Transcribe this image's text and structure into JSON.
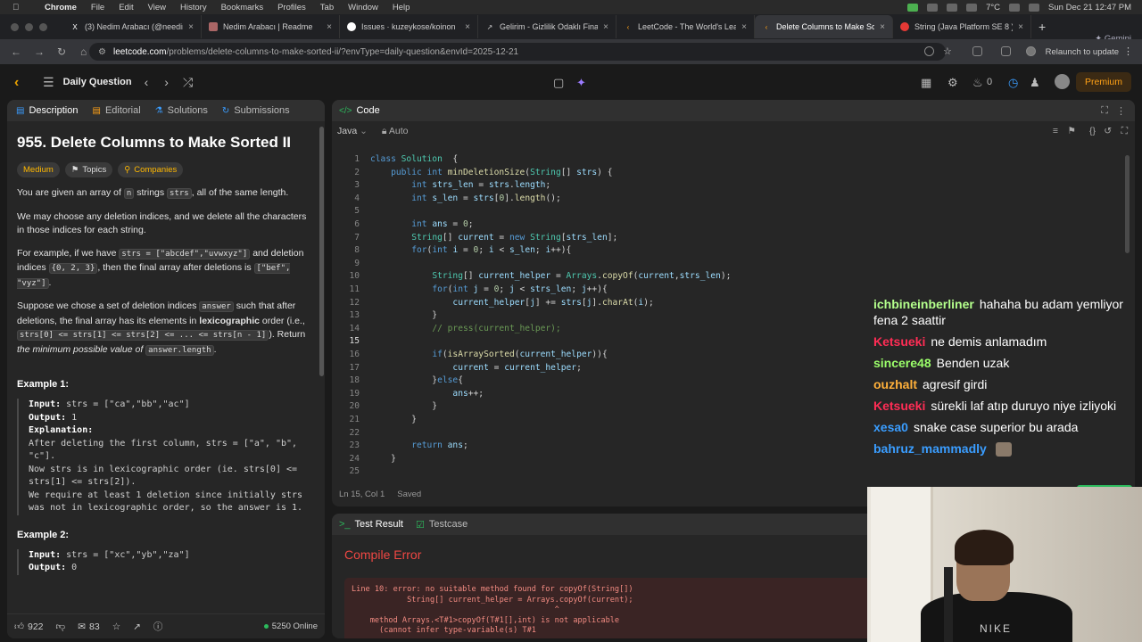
{
  "menubar": {
    "app": "Chrome",
    "items": [
      "File",
      "Edit",
      "View",
      "History",
      "Bookmarks",
      "Profiles",
      "Tab",
      "Window",
      "Help"
    ],
    "temp": "7°C",
    "clock": "Sun Dec 21  12:47 PM"
  },
  "tabs": [
    {
      "title": "(3) Nedim Arabacı (@needim",
      "icon": "x-icon",
      "color": "#ffffff"
    },
    {
      "title": "Nedim Arabacı | Readme",
      "icon": "readme-icon",
      "color": "#a66"
    },
    {
      "title": "Issues · kuzeykose/koinon",
      "icon": "github-icon",
      "color": "#ffffff"
    },
    {
      "title": "Gelirim - Gizlilik Odaklı Finan",
      "icon": "link-icon",
      "color": "#cccccc"
    },
    {
      "title": "LeetCode - The World's Lea",
      "icon": "leetcode-icon",
      "color": "#ffa116"
    },
    {
      "title": "Delete Columns to Make Sor",
      "icon": "leetcode-icon",
      "color": "#ffa116",
      "active": true
    },
    {
      "title": "String (Java Platform SE 8 )",
      "icon": "oracle-icon",
      "color": "#e53935"
    }
  ],
  "gemini": "Gemini",
  "address": {
    "host": "leetcode.com",
    "path": "/problems/delete-columns-to-make-sorted-ii/?envType=daily-question&envId=2025-12-21",
    "relaunch": "Relaunch to update"
  },
  "header": {
    "daily": "Daily Question",
    "fire_count": "0",
    "premium": "Premium"
  },
  "left_tabs": [
    "Description",
    "Editorial",
    "Solutions",
    "Submissions"
  ],
  "problem": {
    "title": "955. Delete Columns to Make Sorted II",
    "difficulty": "Medium",
    "topics": "Topics",
    "companies": "Companies",
    "p1a": "You are given an array of ",
    "p1n": "n",
    "p1b": " strings ",
    "p1strs": "strs",
    "p1c": ", all of the same length.",
    "p2": "We may choose any deletion indices, and we delete all the characters in those indices for each string.",
    "p3a": "For example, if we have ",
    "p3code1": "strs = [\"abcdef\",\"uvwxyz\"]",
    "p3b": " and deletion indices ",
    "p3code2": "{0, 2, 3}",
    "p3c": ", then the final array after deletions is ",
    "p3code3": "[\"bef\", \"vyz\"]",
    "p3d": ".",
    "p4a": "Suppose we chose a set of deletion indices ",
    "p4code1": "answer",
    "p4b": " such that after deletions, the final array has its elements in ",
    "p4bold": "lexicographic",
    "p4c": " order (i.e., ",
    "p4code2": "strs[0] <= strs[1] <= strs[2] <= ... <= strs[n - 1]",
    "p4d": "). Return ",
    "p4em": "the minimum possible value of",
    "p4code3": "answer.length",
    "p4e": ".",
    "ex1_title": "Example 1:",
    "ex1_input_label": "Input:",
    "ex1_input": " strs = [\"ca\",\"bb\",\"ac\"]",
    "ex1_output_label": "Output:",
    "ex1_output": " 1",
    "ex1_expl_label": "Explanation:",
    "ex1_expl": "After deleting the first column, strs = [\"a\", \"b\", \"c\"].\nNow strs is in lexicographic order (ie. strs[0] <= strs[1] <= strs[2]).\nWe require at least 1 deletion since initially strs was not in lexicographic order, so the answer is 1.",
    "ex2_title": "Example 2:",
    "ex2_input_label": "Input:",
    "ex2_input": " strs = [\"xc\",\"yb\",\"za\"]",
    "ex2_output_label": "Output:",
    "ex2_output": " 0"
  },
  "left_footer": {
    "likes": "922",
    "comments": "83",
    "online": "5250 Online"
  },
  "code_panel": {
    "title": "Code",
    "language": "Java",
    "auto": "Auto",
    "status_pos": "Ln 15, Col 1",
    "status_saved": "Saved",
    "current_line": 15,
    "lines": [
      [
        [
          "kw",
          "class "
        ],
        [
          "ty",
          "Solution"
        ],
        [
          "",
          "  {"
        ]
      ],
      [
        [
          "",
          "    "
        ],
        [
          "kw",
          "public int "
        ],
        [
          "fn",
          "minDeletionSize"
        ],
        [
          "",
          "("
        ],
        [
          "ty",
          "String"
        ],
        [
          "",
          "[] "
        ],
        [
          "vr",
          "strs"
        ],
        [
          "",
          ") {"
        ]
      ],
      [
        [
          "",
          "        "
        ],
        [
          "kw",
          "int "
        ],
        [
          "vr",
          "strs_len"
        ],
        [
          "",
          " = "
        ],
        [
          "vr",
          "strs"
        ],
        [
          "",
          "."
        ],
        [
          "vr",
          "length"
        ],
        [
          "",
          ";"
        ]
      ],
      [
        [
          "",
          "        "
        ],
        [
          "kw",
          "int "
        ],
        [
          "vr",
          "s_len"
        ],
        [
          "",
          " = "
        ],
        [
          "vr",
          "strs"
        ],
        [
          "",
          "["
        ],
        [
          "nm",
          "0"
        ],
        [
          "",
          "]."
        ],
        [
          "fn",
          "length"
        ],
        [
          "",
          "();"
        ]
      ],
      [
        [
          "",
          ""
        ]
      ],
      [
        [
          "",
          "        "
        ],
        [
          "kw",
          "int "
        ],
        [
          "vr",
          "ans"
        ],
        [
          "",
          " = "
        ],
        [
          "nm",
          "0"
        ],
        [
          "",
          ";"
        ]
      ],
      [
        [
          "",
          "        "
        ],
        [
          "ty",
          "String"
        ],
        [
          "",
          "[] "
        ],
        [
          "vr",
          "current"
        ],
        [
          "",
          " = "
        ],
        [
          "kw",
          "new "
        ],
        [
          "ty",
          "String"
        ],
        [
          "",
          "["
        ],
        [
          "vr",
          "strs_len"
        ],
        [
          "",
          "];"
        ]
      ],
      [
        [
          "",
          "        "
        ],
        [
          "kw",
          "for"
        ],
        [
          "",
          "("
        ],
        [
          "kw",
          "int "
        ],
        [
          "vr",
          "i"
        ],
        [
          "",
          " = "
        ],
        [
          "nm",
          "0"
        ],
        [
          "",
          "; "
        ],
        [
          "vr",
          "i"
        ],
        [
          "",
          " < "
        ],
        [
          "vr",
          "s_len"
        ],
        [
          "",
          "; "
        ],
        [
          "vr",
          "i"
        ],
        [
          "",
          "++){"
        ]
      ],
      [
        [
          "",
          ""
        ]
      ],
      [
        [
          "",
          "            "
        ],
        [
          "ty",
          "String"
        ],
        [
          "",
          "[] "
        ],
        [
          "vr",
          "current_helper"
        ],
        [
          "",
          " = "
        ],
        [
          "ty",
          "Arrays"
        ],
        [
          "",
          "."
        ],
        [
          "fn",
          "copyOf"
        ],
        [
          "",
          "("
        ],
        [
          "vr",
          "current"
        ],
        [
          "",
          ","
        ],
        [
          "vr",
          "strs_len"
        ],
        [
          "",
          ");"
        ]
      ],
      [
        [
          "",
          "            "
        ],
        [
          "kw",
          "for"
        ],
        [
          "",
          "("
        ],
        [
          "kw",
          "int "
        ],
        [
          "vr",
          "j"
        ],
        [
          "",
          " = "
        ],
        [
          "nm",
          "0"
        ],
        [
          "",
          "; "
        ],
        [
          "vr",
          "j"
        ],
        [
          "",
          " < "
        ],
        [
          "vr",
          "strs_len"
        ],
        [
          "",
          "; "
        ],
        [
          "vr",
          "j"
        ],
        [
          "",
          "++){"
        ]
      ],
      [
        [
          "",
          "                "
        ],
        [
          "vr",
          "current_helper"
        ],
        [
          "",
          "["
        ],
        [
          "vr",
          "j"
        ],
        [
          "",
          "] += "
        ],
        [
          "vr",
          "strs"
        ],
        [
          "",
          "["
        ],
        [
          "vr",
          "j"
        ],
        [
          "",
          "]."
        ],
        [
          "fn",
          "charAt"
        ],
        [
          "",
          "("
        ],
        [
          "vr",
          "i"
        ],
        [
          "",
          ");"
        ]
      ],
      [
        [
          "",
          "            }"
        ]
      ],
      [
        [
          "",
          "            "
        ],
        [
          "cm",
          "// press(current_helper);"
        ]
      ],
      [
        [
          "",
          ""
        ]
      ],
      [
        [
          "",
          "            "
        ],
        [
          "kw",
          "if"
        ],
        [
          "",
          "("
        ],
        [
          "fn",
          "isArraySorted"
        ],
        [
          "",
          "("
        ],
        [
          "vr",
          "current_helper"
        ],
        [
          "",
          ")){"
        ]
      ],
      [
        [
          "",
          "                "
        ],
        [
          "vr",
          "current"
        ],
        [
          "",
          " = "
        ],
        [
          "vr",
          "current_helper"
        ],
        [
          "",
          ";"
        ]
      ],
      [
        [
          "",
          "            }"
        ],
        [
          "kw",
          "else"
        ],
        [
          "",
          "{"
        ]
      ],
      [
        [
          "",
          "                "
        ],
        [
          "vr",
          "ans"
        ],
        [
          "",
          "++;"
        ]
      ],
      [
        [
          "",
          "            }"
        ]
      ],
      [
        [
          "",
          "        }"
        ]
      ],
      [
        [
          "",
          ""
        ]
      ],
      [
        [
          "",
          "        "
        ],
        [
          "kw",
          "return "
        ],
        [
          "vr",
          "ans"
        ],
        [
          "",
          ";"
        ]
      ],
      [
        [
          "",
          "    }"
        ]
      ],
      [
        [
          "",
          ""
        ]
      ]
    ]
  },
  "result_panel": {
    "tab_result": "Test Result",
    "tab_testcase": "Testcase",
    "error_title": "Compile Error",
    "error_text": "Line 10: error: no suitable method found for copyOf(String[])\n            String[] current_helper = Arrays.copyOf(current);\n                                            ^\n    method Arrays.<T#1>copyOf(T#1[],int) is not applicable\n      (cannot infer type-variable(s) T#1"
  },
  "chat": [
    {
      "user": "ichbineinberliner",
      "color": "#b4ff8c",
      "text": "hahaha bu adam yemliyor fena 2 saattir"
    },
    {
      "user": "Ketsueki",
      "color": "#ff2d55",
      "text": "ne demis anlamadım"
    },
    {
      "user": "sincere48",
      "color": "#9bff6a",
      "text": "Benden uzak"
    },
    {
      "user": "ouzhalt",
      "color": "#ffb03a",
      "text": "agresif girdi"
    },
    {
      "user": "Ketsueki",
      "color": "#ff2d55",
      "text": "sürekli laf atıp duruyo niye izliyoki"
    },
    {
      "user": "xesa0",
      "color": "#3a9dff",
      "text": "snake case superior bu arada"
    },
    {
      "user": "bahruz_mammadly",
      "color": "#3a9dff",
      "text": "",
      "emote": true
    }
  ],
  "webcam": {
    "shirt_text": "NIKE"
  }
}
